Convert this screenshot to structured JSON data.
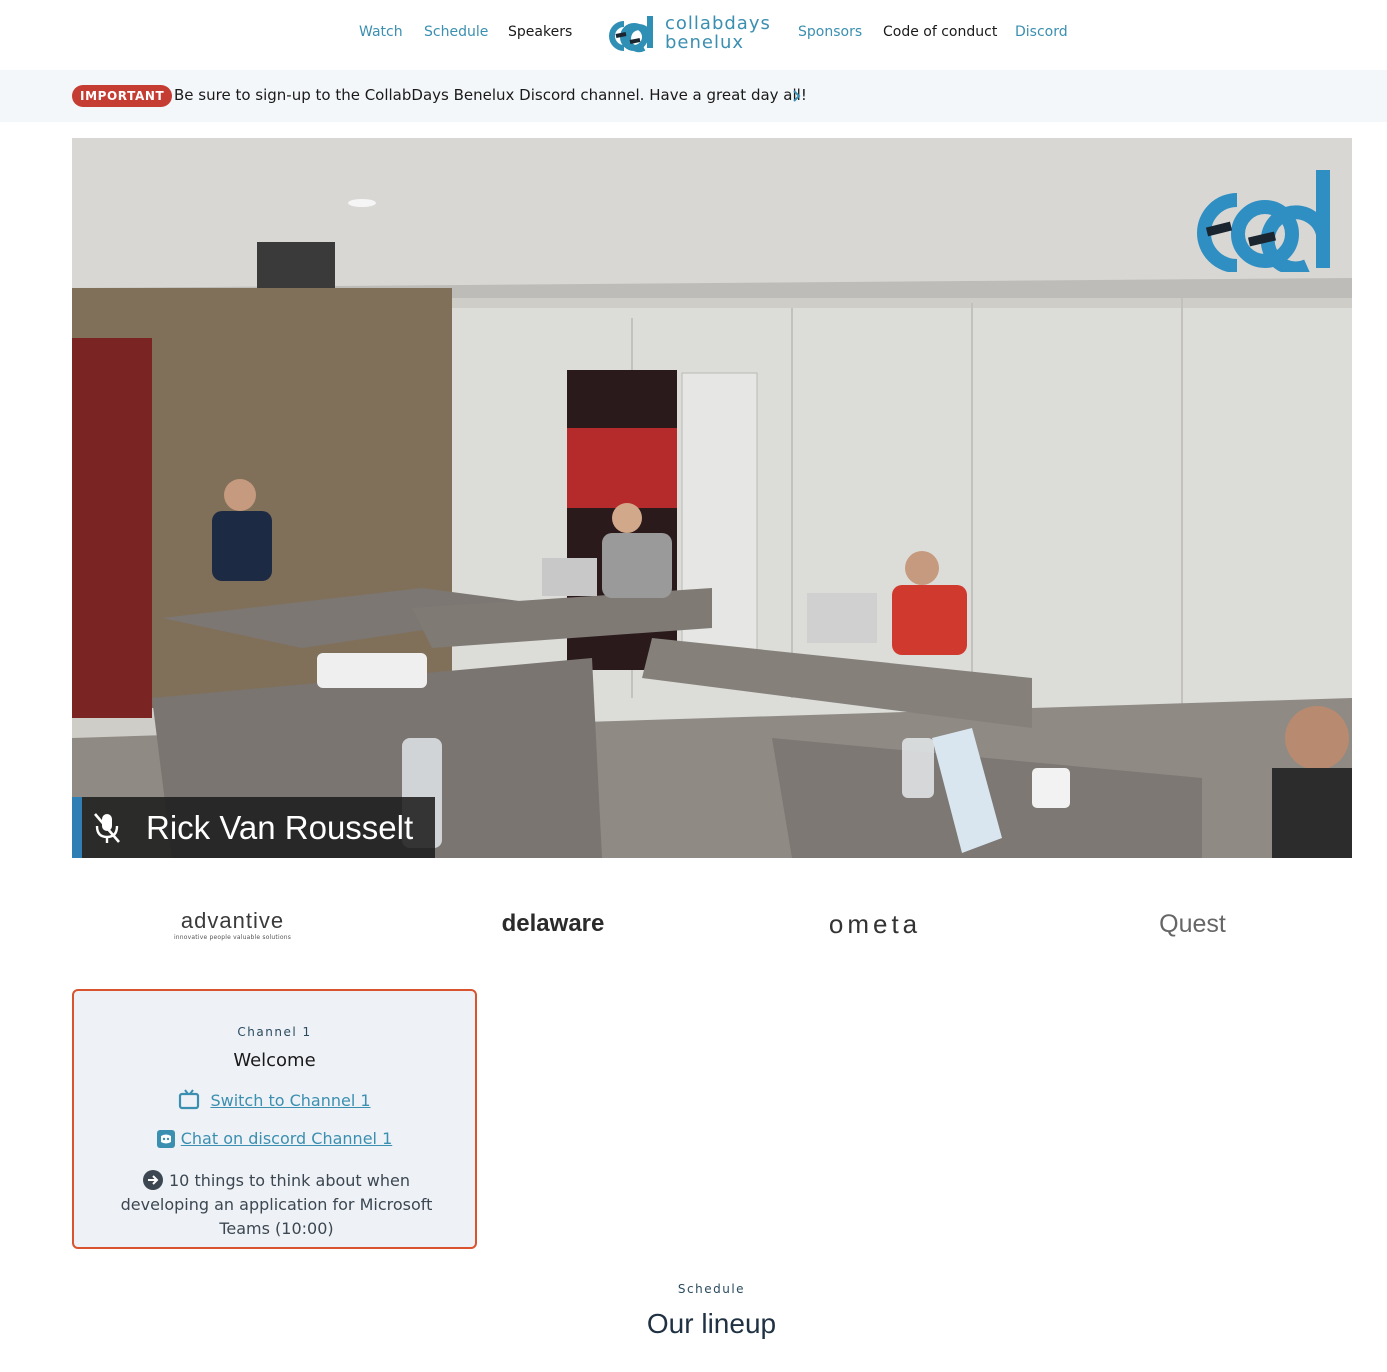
{
  "nav": {
    "watch": "Watch",
    "schedule": "Schedule",
    "speakers": "Speakers",
    "logo_line1": "collabdays",
    "logo_line2": "benelux",
    "sponsors": "Sponsors",
    "code_of_conduct": "Code of conduct",
    "discord": "Discord"
  },
  "banner": {
    "badge": "IMPORTANT",
    "message": "Be sure to sign-up to the CollabDays Benelux Discord channel. Have a great day all!"
  },
  "video": {
    "speaker_name": "Rick Van Rousselt"
  },
  "sponsors": {
    "advantive": "advantive",
    "advantive_tagline": "innovative people valuable solutions",
    "delaware": "delaware",
    "ometa": "ometa",
    "quest": "Quest"
  },
  "channel_card": {
    "eyebrow": "Channel 1",
    "title": "Welcome",
    "switch_link": "Switch to Channel 1",
    "discord_link": "Chat on discord Channel 1",
    "session": "10 things to think about when developing an application for Microsoft Teams (10:00)"
  },
  "lineup": {
    "eyebrow": "Schedule",
    "title": "Our lineup"
  },
  "colors": {
    "accent": "#3b8fb0",
    "badge": "#c53c33",
    "card_border": "#d9532f"
  }
}
